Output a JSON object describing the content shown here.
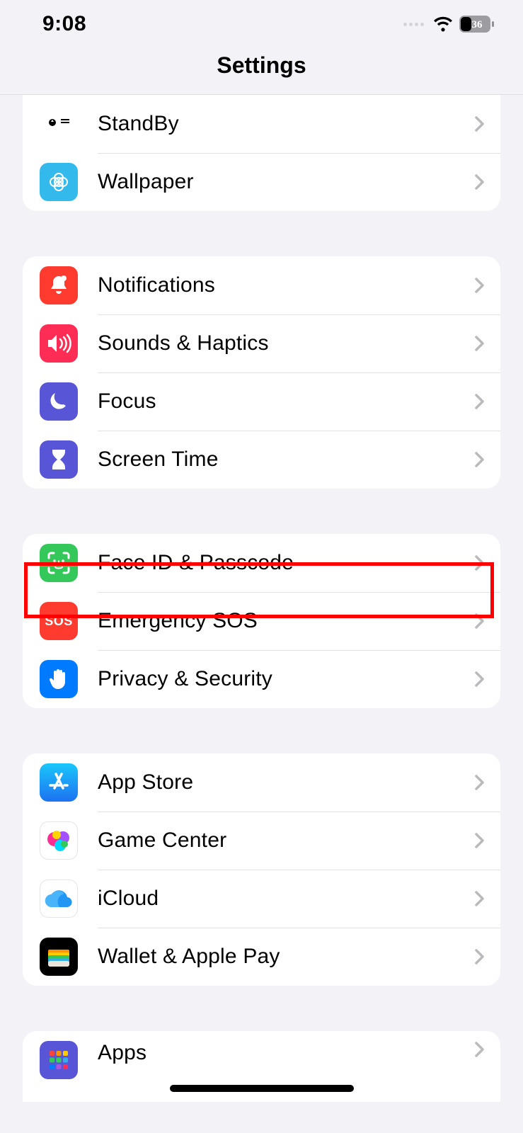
{
  "status": {
    "time": "9:08",
    "battery": "36"
  },
  "header": {
    "title": "Settings"
  },
  "groups": [
    {
      "rows": [
        {
          "id": "standby",
          "label": "StandBy",
          "icon": "standby-icon",
          "bg": "#000000"
        },
        {
          "id": "wallpaper",
          "label": "Wallpaper",
          "icon": "wallpaper-icon",
          "bg": "#33b9ec"
        }
      ]
    },
    {
      "rows": [
        {
          "id": "notifications",
          "label": "Notifications",
          "icon": "bell-icon",
          "bg": "#ff3b30"
        },
        {
          "id": "sounds",
          "label": "Sounds & Haptics",
          "icon": "speaker-icon",
          "bg": "#ff2d55"
        },
        {
          "id": "focus",
          "label": "Focus",
          "icon": "moon-icon",
          "bg": "#5856d6"
        },
        {
          "id": "screentime",
          "label": "Screen Time",
          "icon": "hourglass-icon",
          "bg": "#5856d6"
        }
      ]
    },
    {
      "rows": [
        {
          "id": "faceid",
          "label": "Face ID & Passcode",
          "icon": "faceid-icon",
          "bg": "#34c759",
          "highlighted": true
        },
        {
          "id": "sos",
          "label": "Emergency SOS",
          "icon": "sos-icon",
          "bg": "#ff3b30",
          "text_icon": "SOS"
        },
        {
          "id": "privacy",
          "label": "Privacy & Security",
          "icon": "hand-icon",
          "bg": "#007aff"
        }
      ]
    },
    {
      "rows": [
        {
          "id": "appstore",
          "label": "App Store",
          "icon": "appstore-icon",
          "bg": "#1d9bf6"
        },
        {
          "id": "gamecenter",
          "label": "Game Center",
          "icon": "gamecenter-icon",
          "bg": "#ffffff",
          "bordered": true
        },
        {
          "id": "icloud",
          "label": "iCloud",
          "icon": "cloud-icon",
          "bg": "#ffffff",
          "bordered": true
        },
        {
          "id": "wallet",
          "label": "Wallet & Apple Pay",
          "icon": "wallet-icon",
          "bg": "#000000"
        }
      ]
    },
    {
      "rows": [
        {
          "id": "apps",
          "label": "Apps",
          "icon": "apps-icon",
          "bg": "#5856d6"
        }
      ]
    }
  ]
}
